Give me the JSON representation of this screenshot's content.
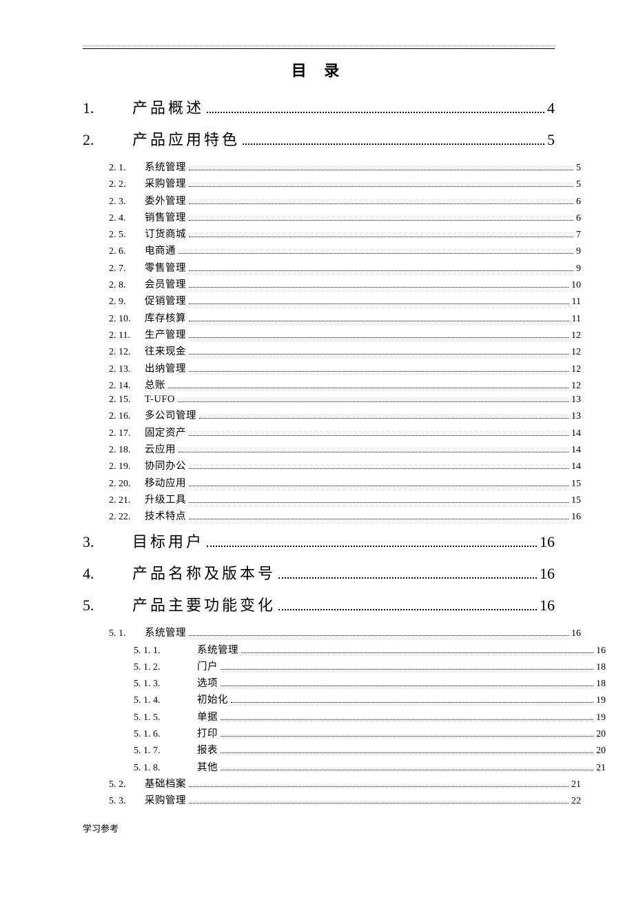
{
  "title": "目 录",
  "footer": "学习参考",
  "toc": [
    {
      "level": 1,
      "num": "1.",
      "label": "产品概述",
      "page": "4"
    },
    {
      "level": 1,
      "num": "2.",
      "label": "产品应用特色",
      "page": "5"
    },
    {
      "level": 2,
      "num": "2. 1.",
      "label": "系统管理",
      "page": "5"
    },
    {
      "level": 2,
      "num": "2. 2.",
      "label": "采购管理",
      "page": "5"
    },
    {
      "level": 2,
      "num": "2. 3.",
      "label": "委外管理",
      "page": "6"
    },
    {
      "level": 2,
      "num": "2. 4.",
      "label": "销售管理",
      "page": "6"
    },
    {
      "level": 2,
      "num": "2. 5.",
      "label": "订货商城",
      "page": "7"
    },
    {
      "level": 2,
      "num": "2. 6.",
      "label": "电商通",
      "page": "9"
    },
    {
      "level": 2,
      "num": "2. 7.",
      "label": "零售管理",
      "page": "9"
    },
    {
      "level": 2,
      "num": "2. 8.",
      "label": "会员管理",
      "page": "10"
    },
    {
      "level": 2,
      "num": "2. 9.",
      "label": "促销管理",
      "page": "11"
    },
    {
      "level": 2,
      "num": "2. 10.",
      "label": "库存核算",
      "page": "11"
    },
    {
      "level": 2,
      "num": "2. 11.",
      "label": "生产管理",
      "page": "12"
    },
    {
      "level": 2,
      "num": "2. 12.",
      "label": "往来现金",
      "page": "12"
    },
    {
      "level": 2,
      "num": "2. 13.",
      "label": "出纳管理",
      "page": "12"
    },
    {
      "level": 2,
      "num": "2. 14.",
      "label": "总账",
      "page": "12"
    },
    {
      "level": 2,
      "num": "2. 15.",
      "label": "T-UFO",
      "page": "13"
    },
    {
      "level": 2,
      "num": "2. 16.",
      "label": "多公司管理",
      "page": "13"
    },
    {
      "level": 2,
      "num": "2. 17.",
      "label": "固定资产",
      "page": "14"
    },
    {
      "level": 2,
      "num": "2. 18.",
      "label": "云应用",
      "page": "14"
    },
    {
      "level": 2,
      "num": "2. 19.",
      "label": "协同办公",
      "page": "14"
    },
    {
      "level": 2,
      "num": "2. 20.",
      "label": "移动应用",
      "page": "15"
    },
    {
      "level": 2,
      "num": "2. 21.",
      "label": "升级工具",
      "page": "15"
    },
    {
      "level": 2,
      "num": "2. 22.",
      "label": "技术特点",
      "page": "16"
    },
    {
      "level": 1,
      "num": "3.",
      "label": "目标用户",
      "page": "16"
    },
    {
      "level": 1,
      "num": "4.",
      "label": "产品名称及版本号",
      "page": "16"
    },
    {
      "level": 1,
      "num": "5.",
      "label": "产品主要功能变化",
      "page": "16"
    },
    {
      "level": 2,
      "num": "5. 1.",
      "label": "系统管理",
      "page": "16"
    },
    {
      "level": 3,
      "num": "5. 1. 1.",
      "label": "系统管理",
      "page": "16"
    },
    {
      "level": 3,
      "num": "5. 1. 2.",
      "label": "门户",
      "page": "18"
    },
    {
      "level": 3,
      "num": "5. 1. 3.",
      "label": "选项",
      "page": "18"
    },
    {
      "level": 3,
      "num": "5. 1. 4.",
      "label": "初始化",
      "page": "19"
    },
    {
      "level": 3,
      "num": "5. 1. 5.",
      "label": "单据",
      "page": "19"
    },
    {
      "level": 3,
      "num": "5. 1. 6.",
      "label": "打印",
      "page": "20"
    },
    {
      "level": 3,
      "num": "5. 1. 7.",
      "label": "报表",
      "page": "20"
    },
    {
      "level": 3,
      "num": "5. 1. 8.",
      "label": "其他",
      "page": "21"
    },
    {
      "level": 2,
      "num": "5. 2.",
      "label": "基础档案",
      "page": "21"
    },
    {
      "level": 2,
      "num": "5. 3.",
      "label": "采购管理",
      "page": "22"
    }
  ]
}
